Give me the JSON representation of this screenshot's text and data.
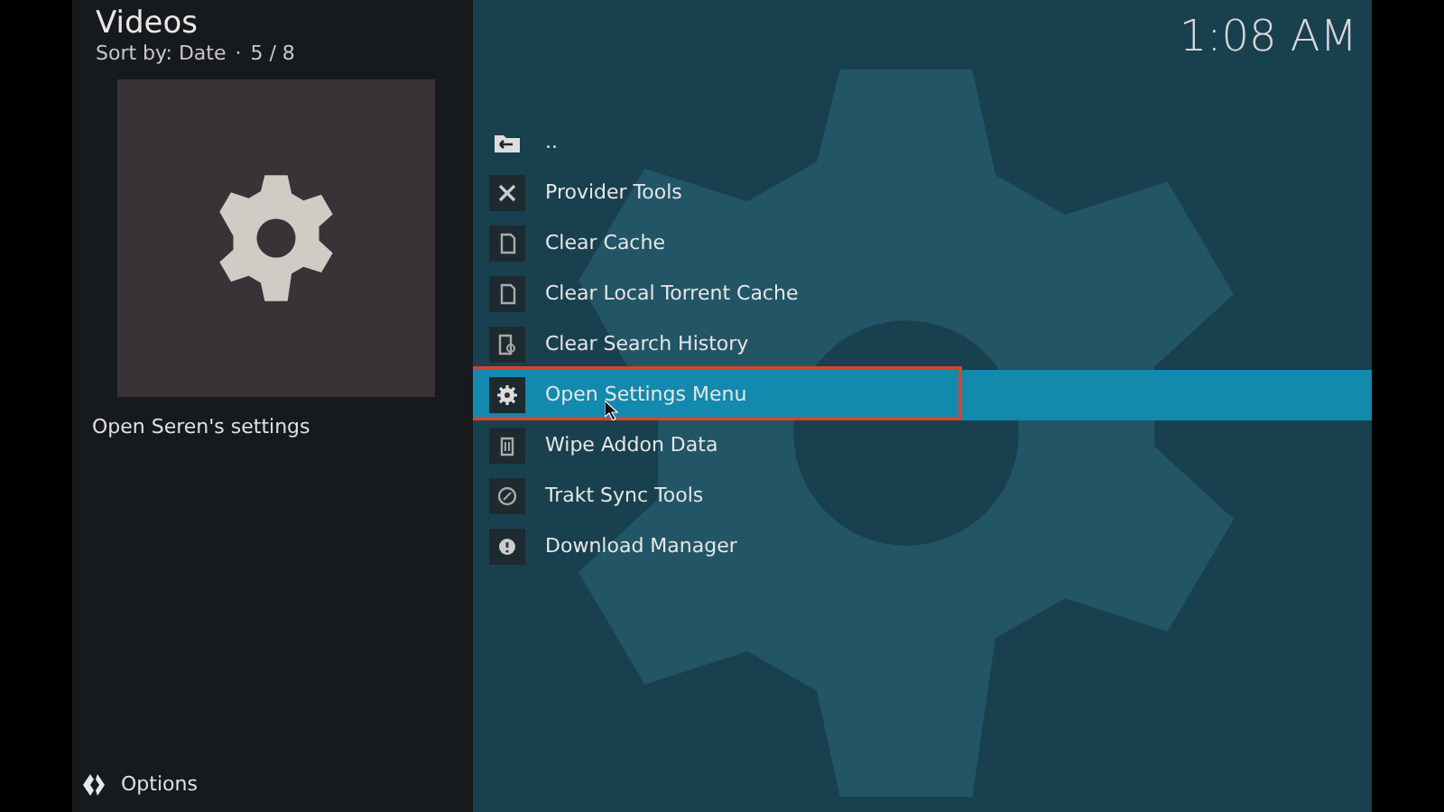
{
  "header": {
    "title": "Videos",
    "sort_label": "Sort by: Date",
    "separator": "·",
    "position": "5 / 8"
  },
  "clock": "1:08 AM",
  "preview": {
    "caption": "Open Seren's settings"
  },
  "list": [
    {
      "kind": "parent",
      "label": "..",
      "selected": false
    },
    {
      "kind": "action",
      "label": "Provider Tools",
      "selected": false
    },
    {
      "kind": "action",
      "label": "Clear Cache",
      "selected": false
    },
    {
      "kind": "action",
      "label": "Clear Local Torrent Cache",
      "selected": false
    },
    {
      "kind": "action",
      "label": "Clear Search History",
      "selected": false
    },
    {
      "kind": "action",
      "label": "Open Settings Menu",
      "selected": true
    },
    {
      "kind": "action",
      "label": "Wipe Addon Data",
      "selected": false
    },
    {
      "kind": "action",
      "label": "Trakt Sync Tools",
      "selected": false
    },
    {
      "kind": "action",
      "label": "Download Manager",
      "selected": false
    }
  ],
  "footer": {
    "label": "Options"
  }
}
